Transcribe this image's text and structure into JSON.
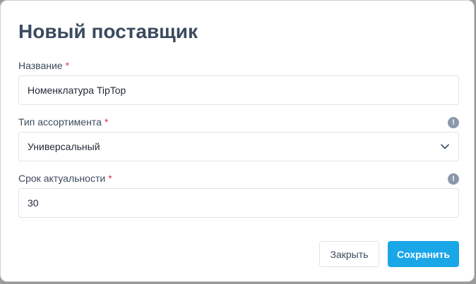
{
  "dialog": {
    "title": "Новый поставщик",
    "required_mark": "*",
    "name_field": {
      "label": "Название",
      "value": "Номенклатура TipTop"
    },
    "assortment_field": {
      "label": "Тип ассортимента",
      "value": "Универсальный",
      "info_icon": "exclamation-circle-icon"
    },
    "relevance_field": {
      "label": "Срок актуальности",
      "value": "30",
      "info_icon": "exclamation-circle-icon"
    },
    "buttons": {
      "close_label": "Закрыть",
      "save_label": "Сохранить"
    },
    "colors": {
      "primary": "#1aa7e8",
      "required": "#e5304f",
      "title": "#3b4a5e",
      "info_icon": "#8a98ab"
    }
  }
}
